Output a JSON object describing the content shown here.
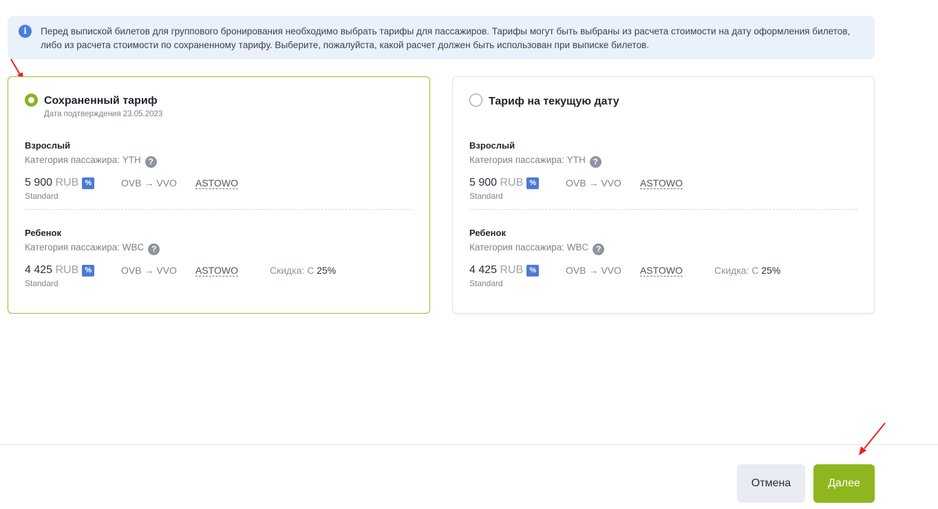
{
  "info": {
    "icon": "info-icon",
    "text": "Перед выпиской билетов для группового бронирования необходимо выбрать тарифы для пассажиров. Тарифы могут быть выбраны из расчета стоимости на дату оформления билетов, либо из расчета стоимости по сохраненному тарифу. Выберите, пожалуйста, какой расчет должен быть использован при выписке билетов."
  },
  "options": [
    {
      "title": "Сохраненный тариф",
      "subtitle": "Дата подтверждения 23.05.2023",
      "selected": true,
      "passengers": [
        {
          "name": "Взрослый",
          "category": "Категория пассажира: YTH",
          "amount": "5 900",
          "currency": "RUB",
          "badge": "%",
          "fare_class": "Standard",
          "route": "OVB → VVO",
          "fare_basis": "ASTOWO",
          "discount_label": "",
          "discount_value": ""
        },
        {
          "name": "Ребенок",
          "category": "Категория пассажира: WBC",
          "amount": "4 425",
          "currency": "RUB",
          "badge": "%",
          "fare_class": "Standard",
          "route": "OVB → VVO",
          "fare_basis": "ASTOWO",
          "discount_label": "Скидка: С",
          "discount_value": "25%"
        }
      ]
    },
    {
      "title": "Тариф на текущую дату",
      "subtitle": "",
      "selected": false,
      "passengers": [
        {
          "name": "Взрослый",
          "category": "Категория пассажира: YTH",
          "amount": "5 900",
          "currency": "RUB",
          "badge": "%",
          "fare_class": "Standard",
          "route": "OVB → VVO",
          "fare_basis": "ASTOWO",
          "discount_label": "",
          "discount_value": ""
        },
        {
          "name": "Ребенок",
          "category": "Категория пассажира: WBC",
          "amount": "4 425",
          "currency": "RUB",
          "badge": "%",
          "fare_class": "Standard",
          "route": "OVB → VVO",
          "fare_basis": "ASTOWO",
          "discount_label": "Скидка: С",
          "discount_value": "25%"
        }
      ]
    }
  ],
  "footer": {
    "cancel_label": "Отмена",
    "next_label": "Далее"
  },
  "colors": {
    "accent": "#8eb71f",
    "info_bg": "#eaf1fb",
    "badge": "#4c79d8",
    "annotation_arrow": "#e8201c"
  }
}
